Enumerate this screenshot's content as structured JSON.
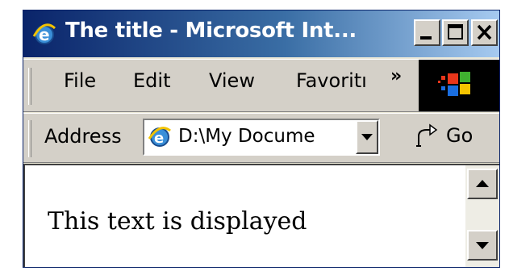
{
  "window": {
    "title": "The title - Microsoft Int...",
    "icon": "ie-icon",
    "controls": [
      "minimize-icon",
      "maximize-icon",
      "close-icon"
    ]
  },
  "menu": {
    "items": [
      "File",
      "Edit",
      "View",
      "Favoritı"
    ],
    "overflow": "»",
    "logo": "windows-logo-icon"
  },
  "address_bar": {
    "label": "Address",
    "value": "D:\\My Docume",
    "icon": "ie-page-icon",
    "go_label": "Go",
    "go_icon": "go-arrow-icon"
  },
  "content": {
    "text": "This text is displayed"
  },
  "colors": {
    "titlebar_start": "#0a246a",
    "titlebar_end": "#a6caf0",
    "face": "#d4d0c8",
    "frame": "#ece9d8"
  }
}
